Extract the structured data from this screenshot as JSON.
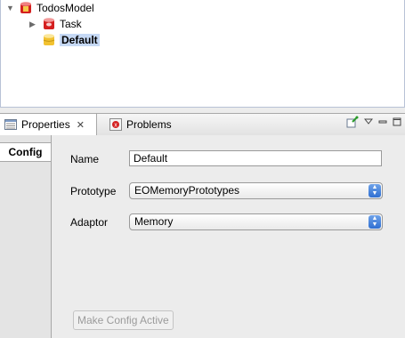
{
  "tree": {
    "items": [
      {
        "label": "TodosModel",
        "expanded": true,
        "icon": "model-db-icon"
      },
      {
        "label": "Task",
        "expanded": false,
        "icon": "entity-icon"
      },
      {
        "label": "Default",
        "selected": true,
        "icon": "connection-db-icon"
      }
    ]
  },
  "tabs": {
    "properties_label": "Properties",
    "problems_label": "Problems"
  },
  "side_tabs": {
    "config_label": "Config"
  },
  "form": {
    "name_label": "Name",
    "name_value": "Default",
    "prototype_label": "Prototype",
    "prototype_value": "EOMemoryPrototypes",
    "adaptor_label": "Adaptor",
    "adaptor_value": "Memory",
    "make_active_label": "Make Config Active"
  },
  "colors": {
    "selection": "#c6d9f5",
    "accent_blue": "#2f6fd2",
    "entity_red": "#d42020",
    "db_yellow": "#f2c230"
  }
}
